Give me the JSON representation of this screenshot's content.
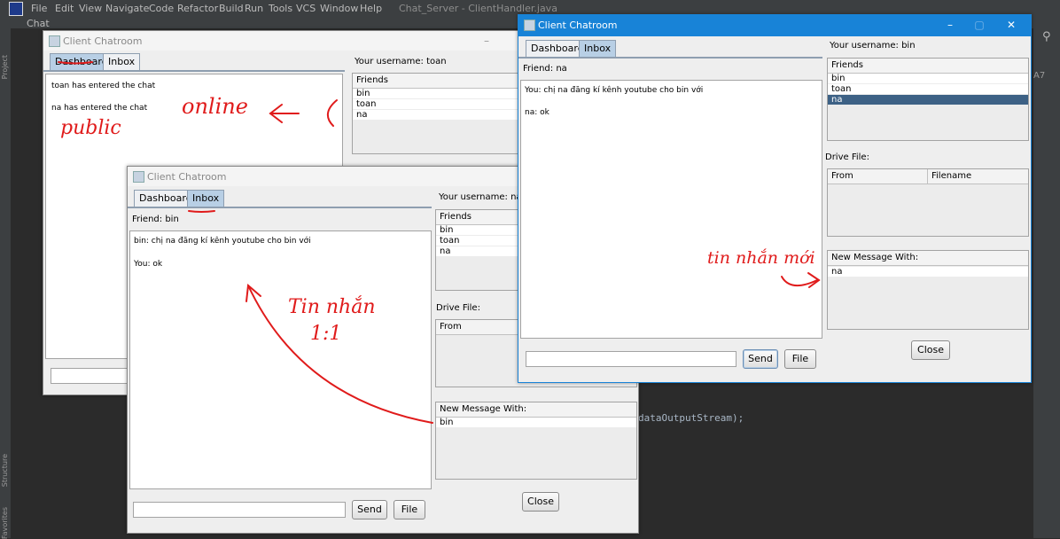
{
  "ide": {
    "menu": [
      "File",
      "Edit",
      "View",
      "Navigate",
      "Code",
      "Refactor",
      "Build",
      "Run",
      "Tools",
      "VCS",
      "Window",
      "Help"
    ],
    "title": "Chat_Server - ClientHandler.java",
    "code_line": "dataOutputStream);",
    "left_tab_label": "Chat",
    "side_labels": {
      "project": "Project",
      "structure": "Structure",
      "favorites": "Favorites"
    },
    "warn_count": "A7"
  },
  "windows": {
    "toan": {
      "title": "Client Chatroom",
      "tabs": [
        "Dashboard",
        "Inbox"
      ],
      "active_tab": "Dashboard",
      "username_label": "Your username:",
      "username": "toan",
      "friends_header": "Friends",
      "friends": [
        "bin",
        "toan",
        "na"
      ],
      "messages": [
        "toan has entered the chat",
        "na has entered the chat"
      ]
    },
    "na": {
      "title": "Client Chatroom",
      "tabs": [
        "Dashboard",
        "Inbox"
      ],
      "active_tab": "Inbox",
      "friend_label": "Friend:",
      "friend": "bin",
      "username_label": "Your username:",
      "username": "na",
      "friends_header": "Friends",
      "friends": [
        "bin",
        "toan",
        "na"
      ],
      "messages": [
        "bin: chị na đăng kí kênh youtube cho bin với",
        "You: ok"
      ],
      "drive_label": "Drive File:",
      "drive_columns": [
        "From"
      ],
      "new_msg_header": "New Message With:",
      "new_msg_items": [
        "bin"
      ],
      "send_label": "Send",
      "file_label": "File",
      "close_label": "Close"
    },
    "bin": {
      "title": "Client Chatroom",
      "tabs": [
        "Dashboard",
        "Inbox"
      ],
      "active_tab": "Inbox",
      "friend_label": "Friend:",
      "friend": "na",
      "username_label": "Your username:",
      "username": "bin",
      "friends_header": "Friends",
      "friends": [
        "bin",
        "toan",
        "na"
      ],
      "selected_friend": "na",
      "messages": [
        "You: chị na đăng kí kênh youtube cho bin với",
        "na: ok"
      ],
      "drive_label": "Drive File:",
      "drive_columns": [
        "From",
        "Filename"
      ],
      "new_msg_header": "New Message With:",
      "new_msg_items": [
        "na"
      ],
      "send_label": "Send",
      "file_label": "File",
      "close_label": "Close"
    }
  },
  "annotations": {
    "online": "online",
    "public": "public",
    "tin_nhan": "Tin nhắn",
    "one_one": "1:1",
    "tin_nhan_moi": "tin nhắn mới"
  },
  "colors": {
    "accent_titlebar": "#1883d7",
    "ink": "#e01b1b",
    "selected_row": "#3d6185"
  }
}
